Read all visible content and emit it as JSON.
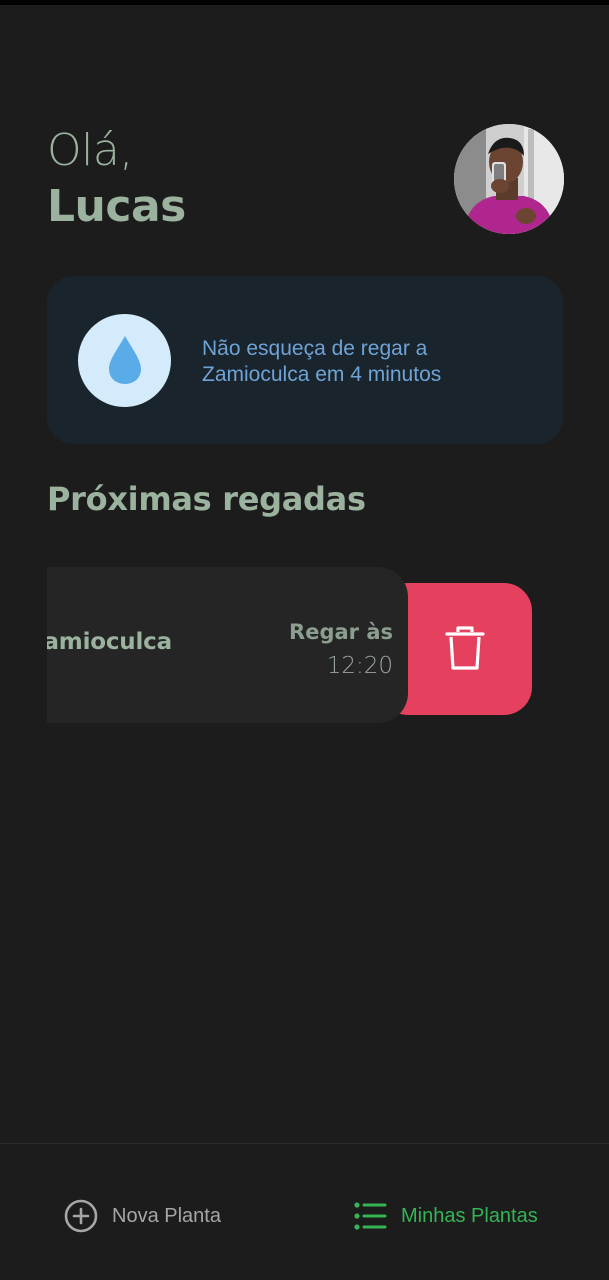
{
  "header": {
    "greeting": "Olá,",
    "user_name": "Lucas",
    "avatar_icon": "user-avatar-photo"
  },
  "reminder": {
    "icon": "water-drop-icon",
    "message": "Não esqueça de regar a Zamioculca em 4 minutos",
    "colors": {
      "background": "#1a242c",
      "text": "#6ea3d6",
      "icon_bg": "#d4ebfb",
      "icon": "#5aace8"
    }
  },
  "section": {
    "title": "Próximas regadas"
  },
  "plants": [
    {
      "name": "Zamioculca",
      "water_label": "Regar às",
      "water_time": "12:20",
      "delete_icon": "trash-icon",
      "delete_color": "#e5405e"
    }
  ],
  "nav": {
    "new_plant": {
      "label": "Nova Planta",
      "icon": "plus-circle-icon"
    },
    "my_plants": {
      "label": "Minhas Plantas",
      "icon": "list-icon",
      "active": true,
      "color": "#34b455"
    }
  }
}
